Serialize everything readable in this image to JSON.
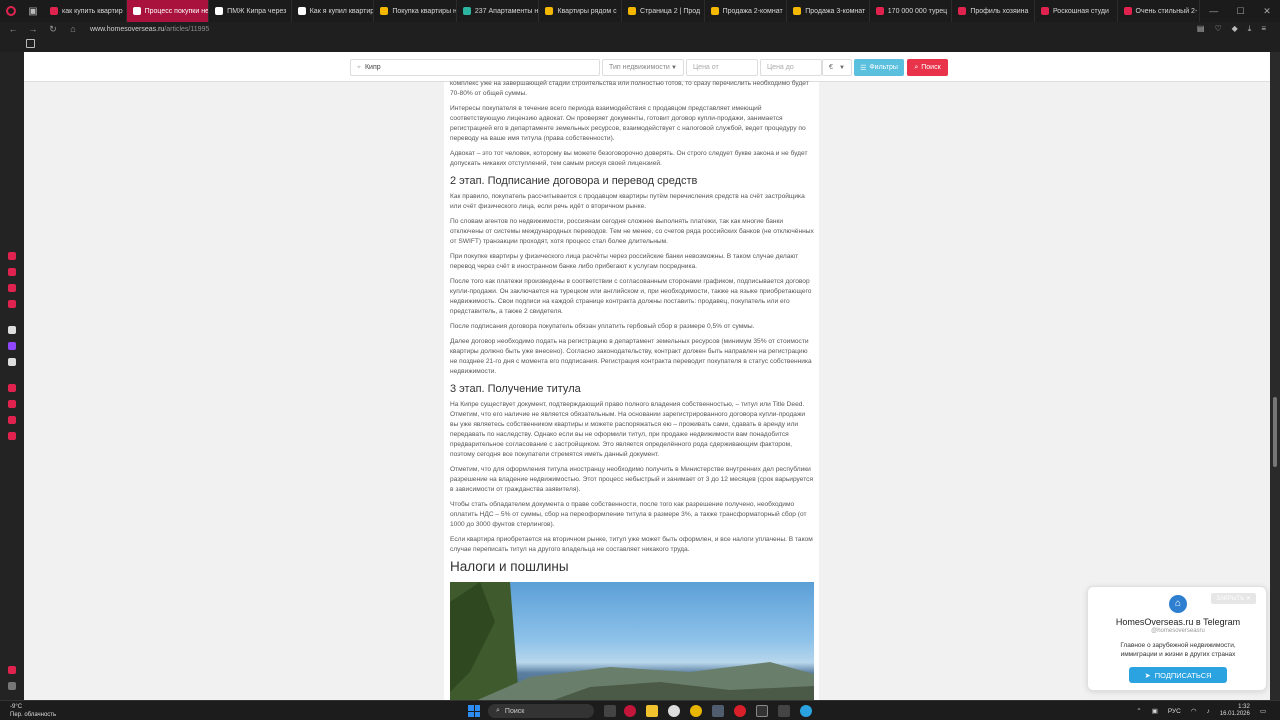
{
  "browser": {
    "tabs": [
      {
        "label": "как купить квартир",
        "color": "#e0234e",
        "active": false
      },
      {
        "label": "Процесс покупки недв",
        "color": "#ffffff",
        "active": true
      },
      {
        "label": "ПМЖ Кипра через",
        "color": "#ffffff",
        "active": false
      },
      {
        "label": "Как я купил квартир",
        "color": "#ffffff",
        "active": false
      },
      {
        "label": "Покупка квартиры н",
        "color": "#f5b800",
        "active": false
      },
      {
        "label": "237 Апартаменты н",
        "color": "#2bb5a0",
        "active": false
      },
      {
        "label": "Квартиры рядом с",
        "color": "#f5b800",
        "active": false
      },
      {
        "label": "Страница 2 | Прод",
        "color": "#f5b800",
        "active": false
      },
      {
        "label": "Продажа 2-комнат",
        "color": "#f5b800",
        "active": false
      },
      {
        "label": "Продажа 3-комнат",
        "color": "#f5b800",
        "active": false
      },
      {
        "label": "170 000 000 турец",
        "color": "#e0234e",
        "active": false
      },
      {
        "label": "Профиль хозяина",
        "color": "#e0234e",
        "active": false
      },
      {
        "label": "Роскошная студи",
        "color": "#e0234e",
        "active": false
      },
      {
        "label": "Очень стильный 2-",
        "color": "#e0234e",
        "active": false
      }
    ],
    "url_domain": "www.homesoverseas.ru",
    "url_path": "/articles/11995"
  },
  "search": {
    "location_value": "Кипр",
    "type_placeholder": "Тип недвижимости",
    "price_from_placeholder": "Цена от",
    "price_to_placeholder": "Цена до",
    "currency": "€",
    "filters_label": "Фильтры",
    "search_label": "Поиск",
    "filters_color": "#5bc0de",
    "search_color": "#e8334a"
  },
  "article": {
    "p0": "комплекс уже на завершающей стадии строительства или полностью готов, то сразу перечислить необходимо будет 70-80% от общей суммы.",
    "p1": "Интересы покупателя в течение всего периода взаимодействия с продавцом представляет имеющий соответствующую лицензию адвокат. Он проверяет документы, готовит договор купли-продажи, занимается регистрацией его в департаменте земельных ресурсов, взаимодействует с налоговой службой, ведет процедуру по переводу на ваше имя титула (права собственности).",
    "p2": "Адвокат – это тот человек, которому вы можете безоговорочно доверять. Он строго следует букве закона и не будет допускать никаких отступлений, тем самым рискуя своей лицензией.",
    "h_stage2": "2 этап. Подписание договора и перевод средств",
    "p3": "Как правило, покупатель рассчитывается с продавцом квартиры путём перечисления средств на счёт застройщика или счёт физического лица, если речь идёт о вторичном рынке.",
    "p4": "По словам агентов по недвижимости, россиянам сегодня сложнее выполнять платежи, так как многие банки отключены от системы международных переводов. Тем не менее, со счетов ряда российских банков (не отключённых от SWIFT) транзакции проходят, хотя процесс стал более длительным.",
    "p5": "При покупке квартиры у физического лица расчёты через российские банки невозможны. В таком случае делают перевод через счёт в иностранном банке либо прибегают к услугам посредника.",
    "p6": "После того как платежи произведены в соответствии с согласованным сторонами графиком, подписывается договор купли-продажи. Он заключается на турецком или английском и, при необходимости, также на языке приобретающего недвижимость. Свои подписи на каждой странице контракта должны поставить: продавец, покупатель или его представитель, а также 2 свидетеля.",
    "p7": "После подписания договора покупатель обязан уплатить гербовый сбор в размере 0,5% от суммы.",
    "p8": "Далее договор необходимо подать на регистрацию в департамент земельных ресурсов (минимум 35% от стоимости квартиры должно быть уже внесено). Согласно законодательству, контракт должен быть направлен на регистрацию не позднее 21-го дня с момента его подписания. Регистрация контракта переводит покупателя в статус собственника недвижимости.",
    "h_stage3": "3 этап. Получение титула",
    "p9": "На Кипре существует документ, подтверждающий право полного владения собственностью, – титул или Title Deed. Отметим, что его наличие не является обязательным. На основании зарегистрированного договора купли-продажи вы уже являетесь собственником квартиры и можете распоряжаться ею – проживать сами, сдавать в аренду или передавать по наследству. Однако если вы не оформили титул, при продаже недвижимости вам понадобится предварительное согласование с застройщиком. Это является определённого рода сдерживающим фактором, поэтому сегодня все покупатели стремятся иметь данный документ.",
    "p10": "Отметим, что для оформления титула иностранцу необходимо получить в Министерстве внутренних дел республики разрешение на владение недвижимостью. Этот процесс небыстрый и занимает от 3 до 12 месяцев (срок варьируется в зависимости от гражданства заявителя).",
    "p11": "Чтобы стать обладателем документа о праве собственности, после того как разрешение получено, необходимо оплатить НДС – 5% от суммы, сбор на переоформление титула в размере 3%, а также трансформаторный сбор (от 1000 до 3000 фунтов стерлингов).",
    "p12": "Если квартира приобретается на вторичном рынке, титул уже может быть оформлен, и все налоги уплачены. В таком случае переписать титул на другого владельца не составляет никакого труда.",
    "h_taxes": "Налоги и пошлины"
  },
  "telegram": {
    "close_label": "ЗАКРЫТЬ ✕",
    "title": "HomesOverseas.ru в Telegram",
    "handle": "@homesoverseasru",
    "description": "Главное о зарубежной недвижимости, иммиграции и жизни в других странах",
    "subscribe_label": "ПОДПИСАТЬСЯ"
  },
  "taskbar": {
    "temperature": "-9°C",
    "weather": "Пер. облачность",
    "search_label": "Поиск",
    "language": "РУС",
    "time": "1:32",
    "date": "16.01.2026"
  }
}
